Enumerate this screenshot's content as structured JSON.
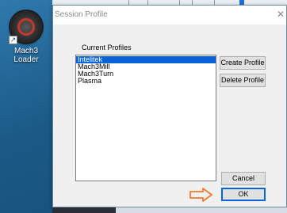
{
  "desktop": {
    "icon": {
      "name": "mach3-logo-icon",
      "label_line1": "Mach3",
      "label_line2": "Loader"
    }
  },
  "dialog": {
    "title": "Session Profile",
    "close_glyph": "✕",
    "profiles_label": "Current Profiles",
    "profiles": [
      {
        "name": "Intelitek",
        "selected": true
      },
      {
        "name": "Mach3Mill",
        "selected": false
      },
      {
        "name": "Mach3Turn",
        "selected": false
      },
      {
        "name": "Plasma",
        "selected": false
      }
    ],
    "buttons": {
      "create": "Create Profile",
      "delete": "Delete Profile",
      "cancel": "Cancel",
      "ok": "OK"
    },
    "annotation": {
      "arrow_icon": "right-arrow-icon",
      "arrow_color": "#f07b2a"
    }
  },
  "colors": {
    "selection": "#0a64d8",
    "desktop": "#1e5c86"
  }
}
